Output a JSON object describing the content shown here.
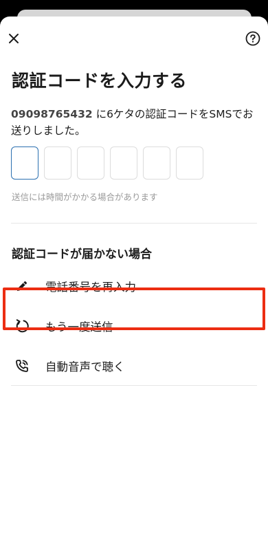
{
  "header": {
    "close_icon": "close-icon",
    "help_icon": "help-circle-icon"
  },
  "title": "認証コードを入力する",
  "description": {
    "phone": "09098765432",
    "text": " に6ケタの認証コードをSMSでお送りしました。"
  },
  "code_inputs": [
    "",
    "",
    "",
    "",
    "",
    ""
  ],
  "hint": "送信には時間がかかる場合があります",
  "section_title": "認証コードが届かない場合",
  "options": [
    {
      "label": "電話番号を再入力",
      "icon": "pencil-icon"
    },
    {
      "label": "もう一度送信",
      "icon": "resend-icon"
    },
    {
      "label": "自動音声で聴く",
      "icon": "phone-call-icon"
    }
  ],
  "colors": {
    "active_border": "#2a6fb0",
    "highlight": "#ec2d12"
  }
}
